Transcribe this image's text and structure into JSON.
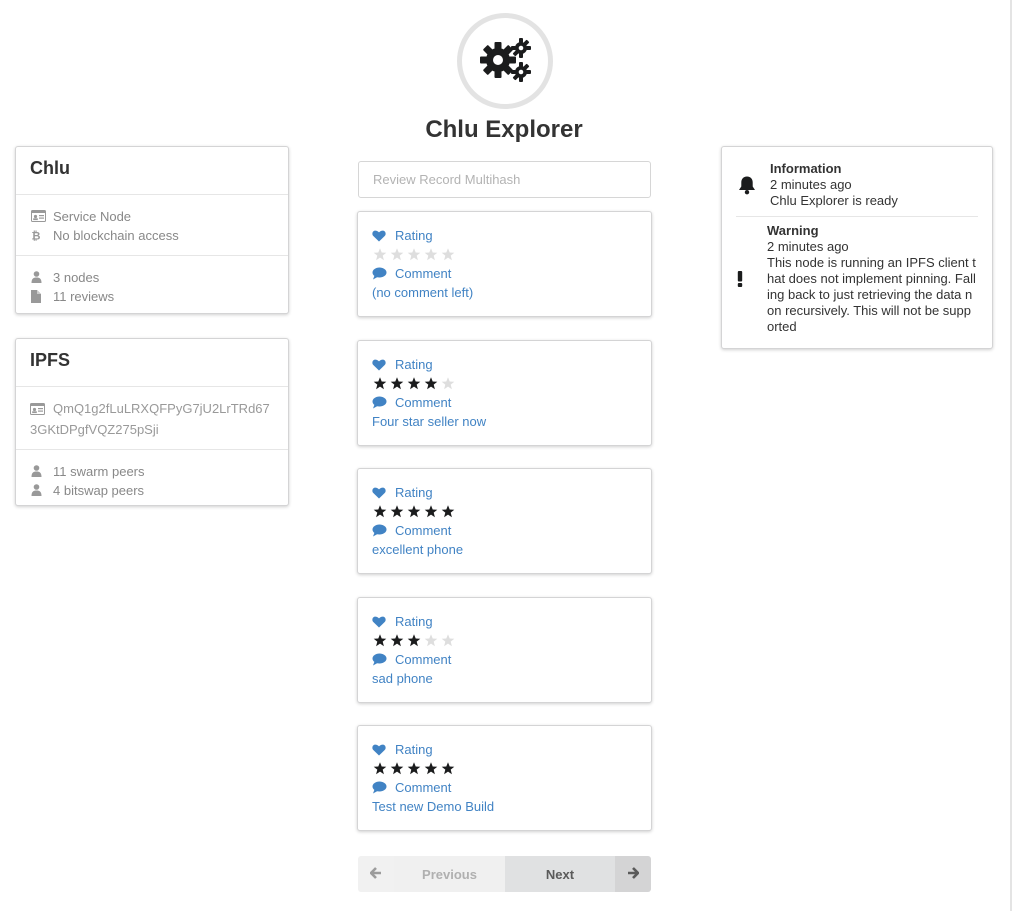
{
  "app": {
    "title": "Chlu Explorer",
    "logo_icon": "cogs-icon"
  },
  "chlu_card": {
    "title": "Chlu",
    "rows_1": [
      {
        "icon": "id-card-icon",
        "text": "Service Node"
      },
      {
        "icon": "bitcoin-icon",
        "text": "No blockchain access"
      }
    ],
    "rows_2": [
      {
        "icon": "user-icon",
        "text": "3 nodes"
      },
      {
        "icon": "file-icon",
        "text": "11 reviews"
      }
    ]
  },
  "ipfs_card": {
    "title": "IPFS",
    "node_id_icon": "id-card-icon",
    "node_id": "QmQ1g2fLuLRXQFPyG7jU2LrTRd673GKtDPgfVQZ275pSji",
    "rows_2": [
      {
        "icon": "user-icon",
        "text": "11 swarm peers"
      },
      {
        "icon": "user-icon",
        "text": "4 bitswap peers"
      }
    ]
  },
  "search": {
    "placeholder": "Review Record Multihash",
    "value": ""
  },
  "reviews": [
    {
      "rating_label": "Rating",
      "rating": 0,
      "max": 5,
      "comment_label": "Comment",
      "comment": "(no comment left)"
    },
    {
      "rating_label": "Rating",
      "rating": 4,
      "max": 5,
      "comment_label": "Comment",
      "comment": "Four star seller now"
    },
    {
      "rating_label": "Rating",
      "rating": 5,
      "max": 5,
      "comment_label": "Comment",
      "comment": "excellent phone"
    },
    {
      "rating_label": "Rating",
      "rating": 3,
      "max": 5,
      "comment_label": "Comment",
      "comment": "sad phone"
    },
    {
      "rating_label": "Rating",
      "rating": 5,
      "max": 5,
      "comment_label": "Comment",
      "comment": "Test new Demo Build"
    }
  ],
  "pagination": {
    "previous_label": "Previous",
    "next_label": "Next"
  },
  "notifications": [
    {
      "icon": "bell-icon",
      "title": "Information",
      "time": "2 minutes ago",
      "message": "Chlu Explorer is ready"
    },
    {
      "icon": "exclamation-icon",
      "title": "Warning",
      "time": "2 minutes ago",
      "message": "This node is running an IPFS client that does not implement pinning. Falling back to just retrieving the data non recursively. This will not be supported"
    }
  ],
  "colors": {
    "link": "#4183c4",
    "star_filled": "#1b1c1d",
    "star_empty": "#dedede"
  }
}
